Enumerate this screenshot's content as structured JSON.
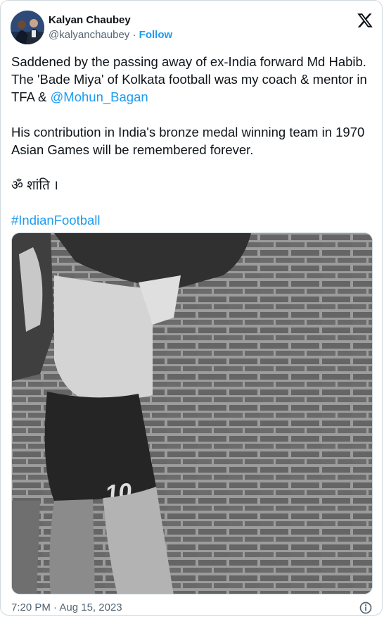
{
  "tweet": {
    "author": {
      "name": "Kalyan Chaubey",
      "handle": "@kalyanchaubey",
      "separator": " · ",
      "follow_label": "Follow"
    },
    "body": {
      "p1_text": "Saddened by the passing away of ex-India forward Md Habib. The 'Bade Miya' of Kolkata football was my coach & mentor in TFA & ",
      "p1_mention": "@Mohun_Bagan",
      "p2": "His contribution in India's bronze medal winning team in 1970 Asian Games will be remembered forever.",
      "p3": "ॐ शांति ।",
      "hashtag": "#IndianFootball"
    },
    "media": {
      "jersey_number": "10"
    },
    "footer": {
      "time": "7:20 PM",
      "separator": " · ",
      "date": "Aug 15, 2023"
    }
  },
  "icons": {
    "brand": "x-logo-icon",
    "info": "info-icon"
  },
  "colors": {
    "link": "#1d9bf0",
    "secondary_text": "#536471",
    "border": "#cfd9de",
    "primary_text": "#0f1419"
  }
}
